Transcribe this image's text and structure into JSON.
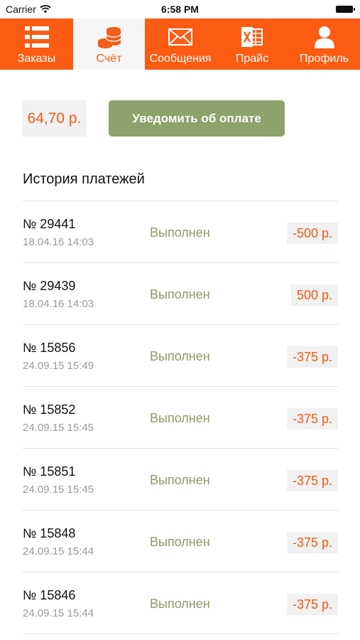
{
  "status_bar": {
    "carrier": "Carrier",
    "time": "6:58 PM"
  },
  "colors": {
    "accent": "#fb5b12",
    "button_green": "#8ea26b",
    "status_green": "#8a9a6a",
    "amount_orange": "#f05a14"
  },
  "tabs": [
    {
      "label": "Заказы",
      "icon": "list-icon",
      "active": false
    },
    {
      "label": "Счёт",
      "icon": "coins-icon",
      "active": true
    },
    {
      "label": "Сообщения",
      "icon": "envelope-icon",
      "active": false
    },
    {
      "label": "Прайс",
      "icon": "excel-icon",
      "active": false
    },
    {
      "label": "Профиль",
      "icon": "person-icon",
      "active": false
    }
  ],
  "balance": {
    "value": "64,70 р.",
    "notify_label": "Уведомить об оплате"
  },
  "history": {
    "title": "История платежей",
    "items": [
      {
        "number": "№ 29441",
        "date": "18.04.16 14:03",
        "status": "Выполнен",
        "amount": "-500 р."
      },
      {
        "number": "№ 29439",
        "date": "18.04.16 14:03",
        "status": "Выполнен",
        "amount": "500 р."
      },
      {
        "number": "№ 15856",
        "date": "24.09.15 15:49",
        "status": "Выполнен",
        "amount": "-375 р."
      },
      {
        "number": "№ 15852",
        "date": "24.09.15 15:45",
        "status": "Выполнен",
        "amount": "-375 р."
      },
      {
        "number": "№ 15851",
        "date": "24.09.15 15:45",
        "status": "Выполнен",
        "amount": "-375 р."
      },
      {
        "number": "№ 15848",
        "date": "24.09.15 15:44",
        "status": "Выполнен",
        "amount": "-375 р."
      },
      {
        "number": "№ 15846",
        "date": "24.09.15 15:44",
        "status": "Выполнен",
        "amount": "-375 р."
      }
    ]
  }
}
